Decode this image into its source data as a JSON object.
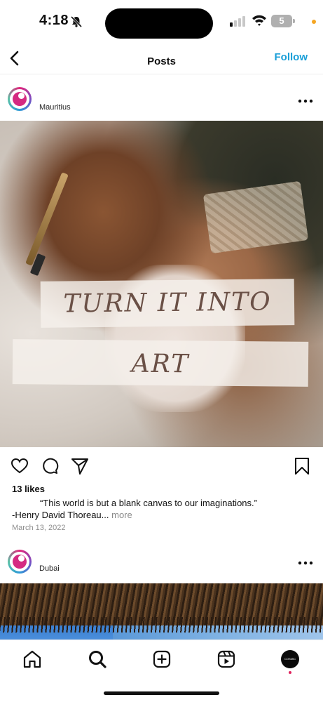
{
  "status_bar": {
    "time": "4:18",
    "battery": "5"
  },
  "nav": {
    "title": "Posts",
    "follow_label": "Follow"
  },
  "posts": [
    {
      "location": "Mauritius",
      "image_text_line1": "TURN IT INTO",
      "image_text_line2": "ART",
      "likes": "13 likes",
      "caption_line1": "“This world is but a blank canvas to our imaginations.”",
      "caption_line2": "-Henry David Thoreau...",
      "more_label": "more",
      "date": "March 13, 2022"
    },
    {
      "location": "Dubai"
    }
  ],
  "tabbar": {
    "profile_avatar_text": "COSMIC"
  },
  "icons": {
    "back": "chevron-left-icon",
    "more": "more-horizontal-icon",
    "like": "heart-icon",
    "comment": "comment-icon",
    "share": "send-icon",
    "save": "bookmark-icon",
    "home": "home-icon",
    "search": "search-icon",
    "create": "plus-square-icon",
    "reels": "reels-icon"
  },
  "colors": {
    "accent": "#1a9fd8",
    "notification": "#e0245e"
  }
}
